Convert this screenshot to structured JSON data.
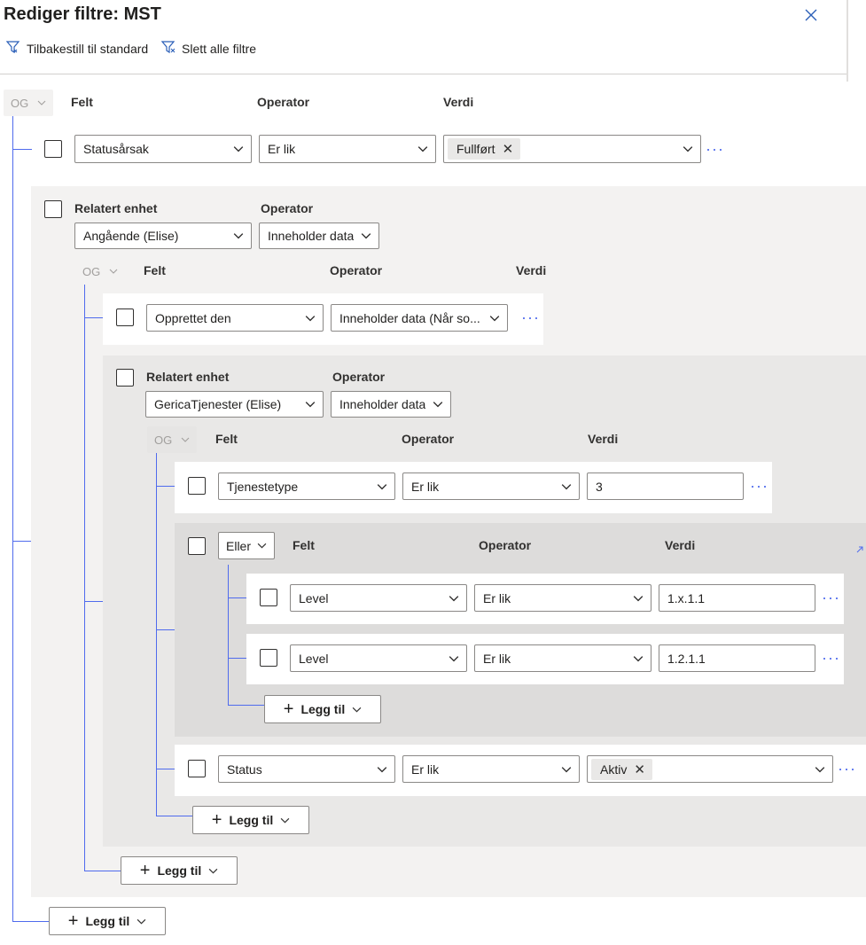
{
  "header": {
    "title": "Rediger filtre: MST",
    "reset_label": "Tilbakestill til standard",
    "delete_all_label": "Slett alle filtre"
  },
  "root": {
    "logic": "OG",
    "col_field": "Felt",
    "col_operator": "Operator",
    "col_value": "Verdi",
    "add_label": "Legg til",
    "row1": {
      "field": "Statusårsak",
      "operator": "Er lik",
      "tag": "Fullført"
    }
  },
  "rel1": {
    "entity_label": "Relatert enhet",
    "operator_label": "Operator",
    "entity": "Angående (Elise)",
    "operator": "Inneholder data",
    "logic": "OG",
    "col_field": "Felt",
    "col_operator": "Operator",
    "col_value": "Verdi",
    "add_label": "Legg til",
    "row1": {
      "field": "Opprettet den",
      "operator": "Inneholder data (Når so..."
    }
  },
  "rel2": {
    "entity_label": "Relatert enhet",
    "operator_label": "Operator",
    "entity": "GericaTjenester (Elise)",
    "operator": "Inneholder data",
    "logic": "OG",
    "col_field": "Felt",
    "col_operator": "Operator",
    "col_value": "Verdi",
    "add_label": "Legg til",
    "row1": {
      "field": "Tjenestetype",
      "operator": "Er lik",
      "value": "3"
    },
    "row_status": {
      "field": "Status",
      "operator": "Er lik",
      "tag": "Aktiv"
    }
  },
  "group_or": {
    "logic": "Eller",
    "col_field": "Felt",
    "col_operator": "Operator",
    "col_value": "Verdi",
    "add_label": "Legg til",
    "row1": {
      "field": "Level",
      "operator": "Er lik",
      "value": "1.x.1.1"
    },
    "row2": {
      "field": "Level",
      "operator": "Er lik",
      "value": "1.2.1.1"
    }
  }
}
